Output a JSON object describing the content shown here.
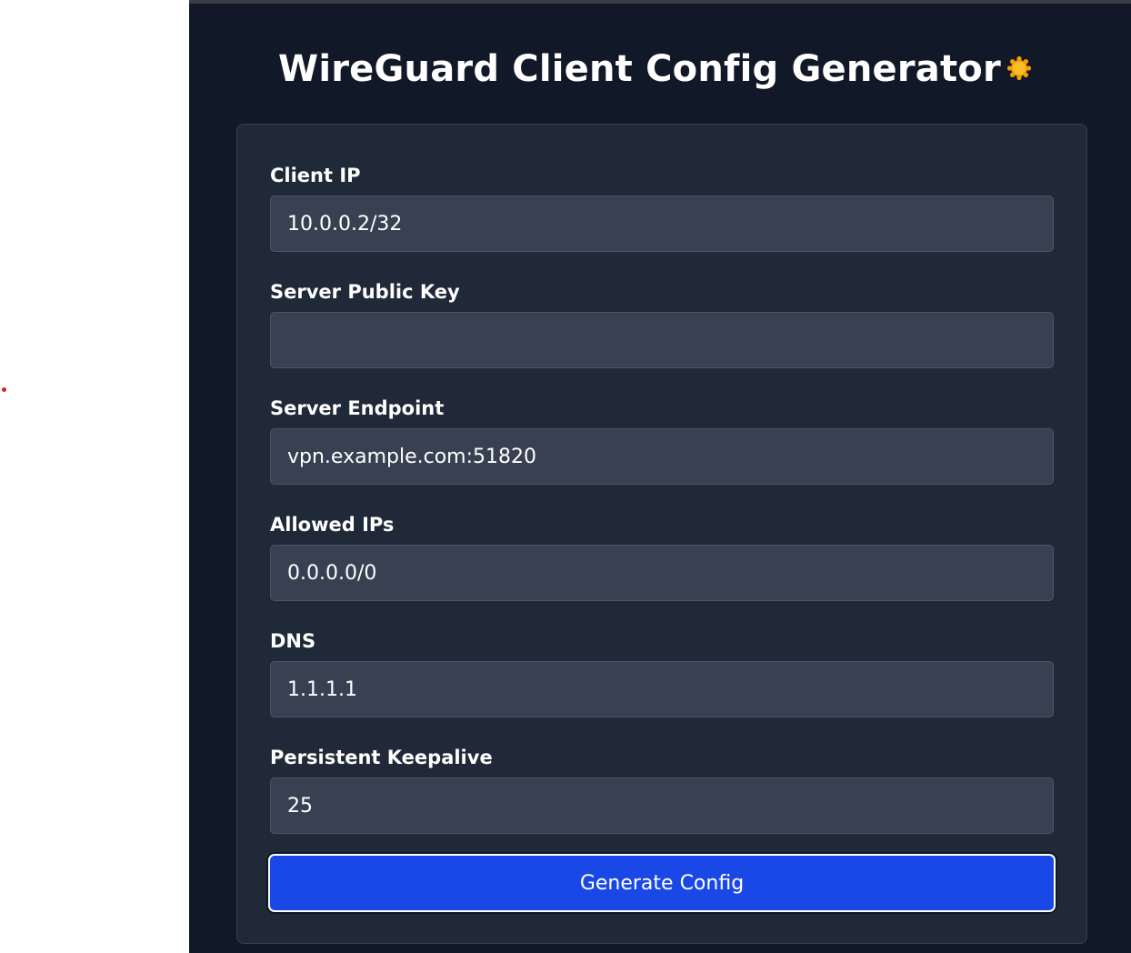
{
  "header": {
    "title": "WireGuard Client Config Generator",
    "theme_toggle_icon": "sun-icon",
    "theme_toggle_color": "#f59e0b"
  },
  "form": {
    "fields": [
      {
        "label": "Client IP",
        "value": "10.0.0.2/32"
      },
      {
        "label": "Server Public Key",
        "value": ""
      },
      {
        "label": "Server Endpoint",
        "value": "vpn.example.com:51820"
      },
      {
        "label": "Allowed IPs",
        "value": "0.0.0.0/0"
      },
      {
        "label": "DNS",
        "value": "1.1.1.1"
      },
      {
        "label": "Persistent Keepalive",
        "value": "25"
      }
    ],
    "submit_label": "Generate Config"
  },
  "colors": {
    "background": "#111827",
    "card": "#1f2937",
    "input": "#374151",
    "accent": "#1a48e6"
  }
}
